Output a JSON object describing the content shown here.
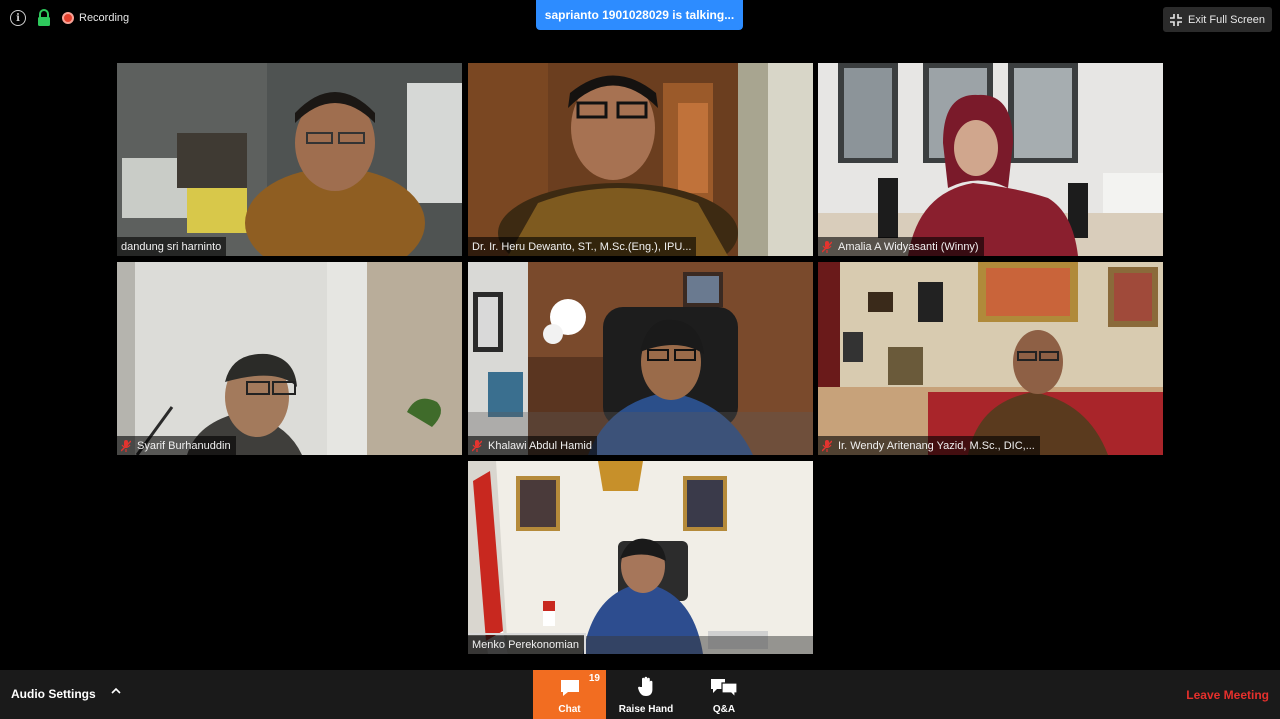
{
  "status": {
    "recording_label": "Recording"
  },
  "talking_banner": "saprianto 1901028029 is talking...",
  "exit_fullscreen_label": "Exit Full Screen",
  "participants": [
    {
      "name": "dandung sri harninto",
      "muted": false
    },
    {
      "name": "Dr. Ir. Heru Dewanto, ST., M.Sc.(Eng.), IPU...",
      "muted": false
    },
    {
      "name": "Amalia A Widyasanti (Winny)",
      "muted": true
    },
    {
      "name": "Syarif Burhanuddin",
      "muted": true
    },
    {
      "name": "Khalawi Abdul Hamid",
      "muted": true
    },
    {
      "name": "Ir. Wendy Aritenang Yazid, M.Sc., DIC,...",
      "muted": true
    },
    {
      "name": "Menko Perekonomian",
      "muted": false
    }
  ],
  "toolbar": {
    "audio_settings": "Audio Settings",
    "chat_label": "Chat",
    "chat_count": "19",
    "raise_hand_label": "Raise Hand",
    "qa_label": "Q&A",
    "leave_label": "Leave Meeting"
  },
  "colors": {
    "accent_blue": "#2d8cff",
    "chat_orange": "#f26d21",
    "leave_red": "#e5302c",
    "recording_red": "#e4402d",
    "lock_green": "#2ec95c"
  }
}
